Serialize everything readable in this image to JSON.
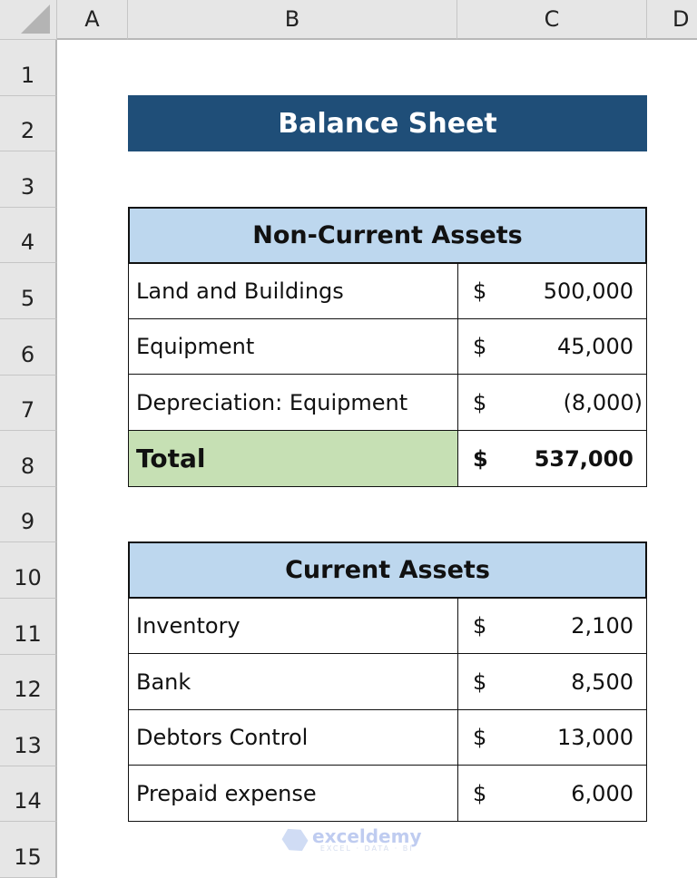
{
  "columns": [
    "A",
    "B",
    "C",
    "D"
  ],
  "rows": [
    "1",
    "2",
    "3",
    "4",
    "5",
    "6",
    "7",
    "8",
    "9",
    "10",
    "11",
    "12",
    "13",
    "14",
    "15"
  ],
  "title": "Balance Sheet",
  "non_current_assets": {
    "header": "Non-Current Assets",
    "items": [
      {
        "label": "Land and Buildings",
        "currency": "$",
        "amount": "500,000"
      },
      {
        "label": "Equipment",
        "currency": "$",
        "amount": "45,000"
      },
      {
        "label": "Depreciation: Equipment",
        "currency": "$",
        "amount": "(8,000)"
      }
    ],
    "total": {
      "label": "Total",
      "currency": "$",
      "amount": "537,000"
    }
  },
  "current_assets": {
    "header": "Current Assets",
    "items": [
      {
        "label": "Inventory",
        "currency": "$",
        "amount": "2,100"
      },
      {
        "label": "Bank",
        "currency": "$",
        "amount": "8,500"
      },
      {
        "label": "Debtors Control",
        "currency": "$",
        "amount": "13,000"
      },
      {
        "label": "Prepaid expense",
        "currency": "$",
        "amount": "6,000"
      }
    ]
  },
  "watermark": {
    "brand": "exceldemy",
    "tagline": "EXCEL · DATA · BI"
  },
  "colors": {
    "title_bg": "#1f4e78",
    "section_header_bg": "#bdd7ee",
    "total_bg": "#c6e0b4"
  }
}
